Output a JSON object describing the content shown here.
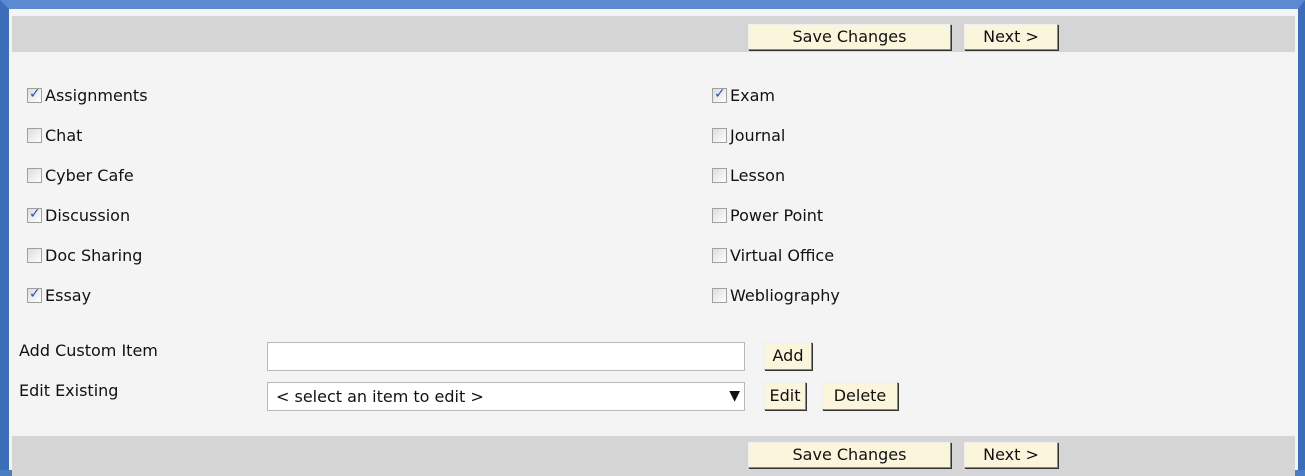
{
  "toolbar": {
    "save_label": "Save Changes",
    "next_label": "Next >"
  },
  "tools_left": [
    {
      "label": "Assignments",
      "checked": true
    },
    {
      "label": "Chat",
      "checked": false
    },
    {
      "label": "Cyber Cafe",
      "checked": false
    },
    {
      "label": "Discussion",
      "checked": true
    },
    {
      "label": "Doc Sharing",
      "checked": false
    },
    {
      "label": "Essay",
      "checked": true
    }
  ],
  "tools_right": [
    {
      "label": "Exam",
      "checked": true
    },
    {
      "label": "Journal",
      "checked": false
    },
    {
      "label": "Lesson",
      "checked": false
    },
    {
      "label": "Power Point",
      "checked": false
    },
    {
      "label": "Virtual Office",
      "checked": false
    },
    {
      "label": "Webliography",
      "checked": false
    }
  ],
  "custom": {
    "add_label": "Add Custom Item",
    "add_value": "",
    "add_button": "Add",
    "edit_label": "Edit Existing",
    "edit_selected": "< select an item to edit >",
    "edit_button": "Edit",
    "delete_button": "Delete"
  },
  "colors": {
    "frame": "#3c6db8",
    "bar": "#d5d5d5",
    "button": "#fbf5dc",
    "panel": "#f4f4f4"
  }
}
